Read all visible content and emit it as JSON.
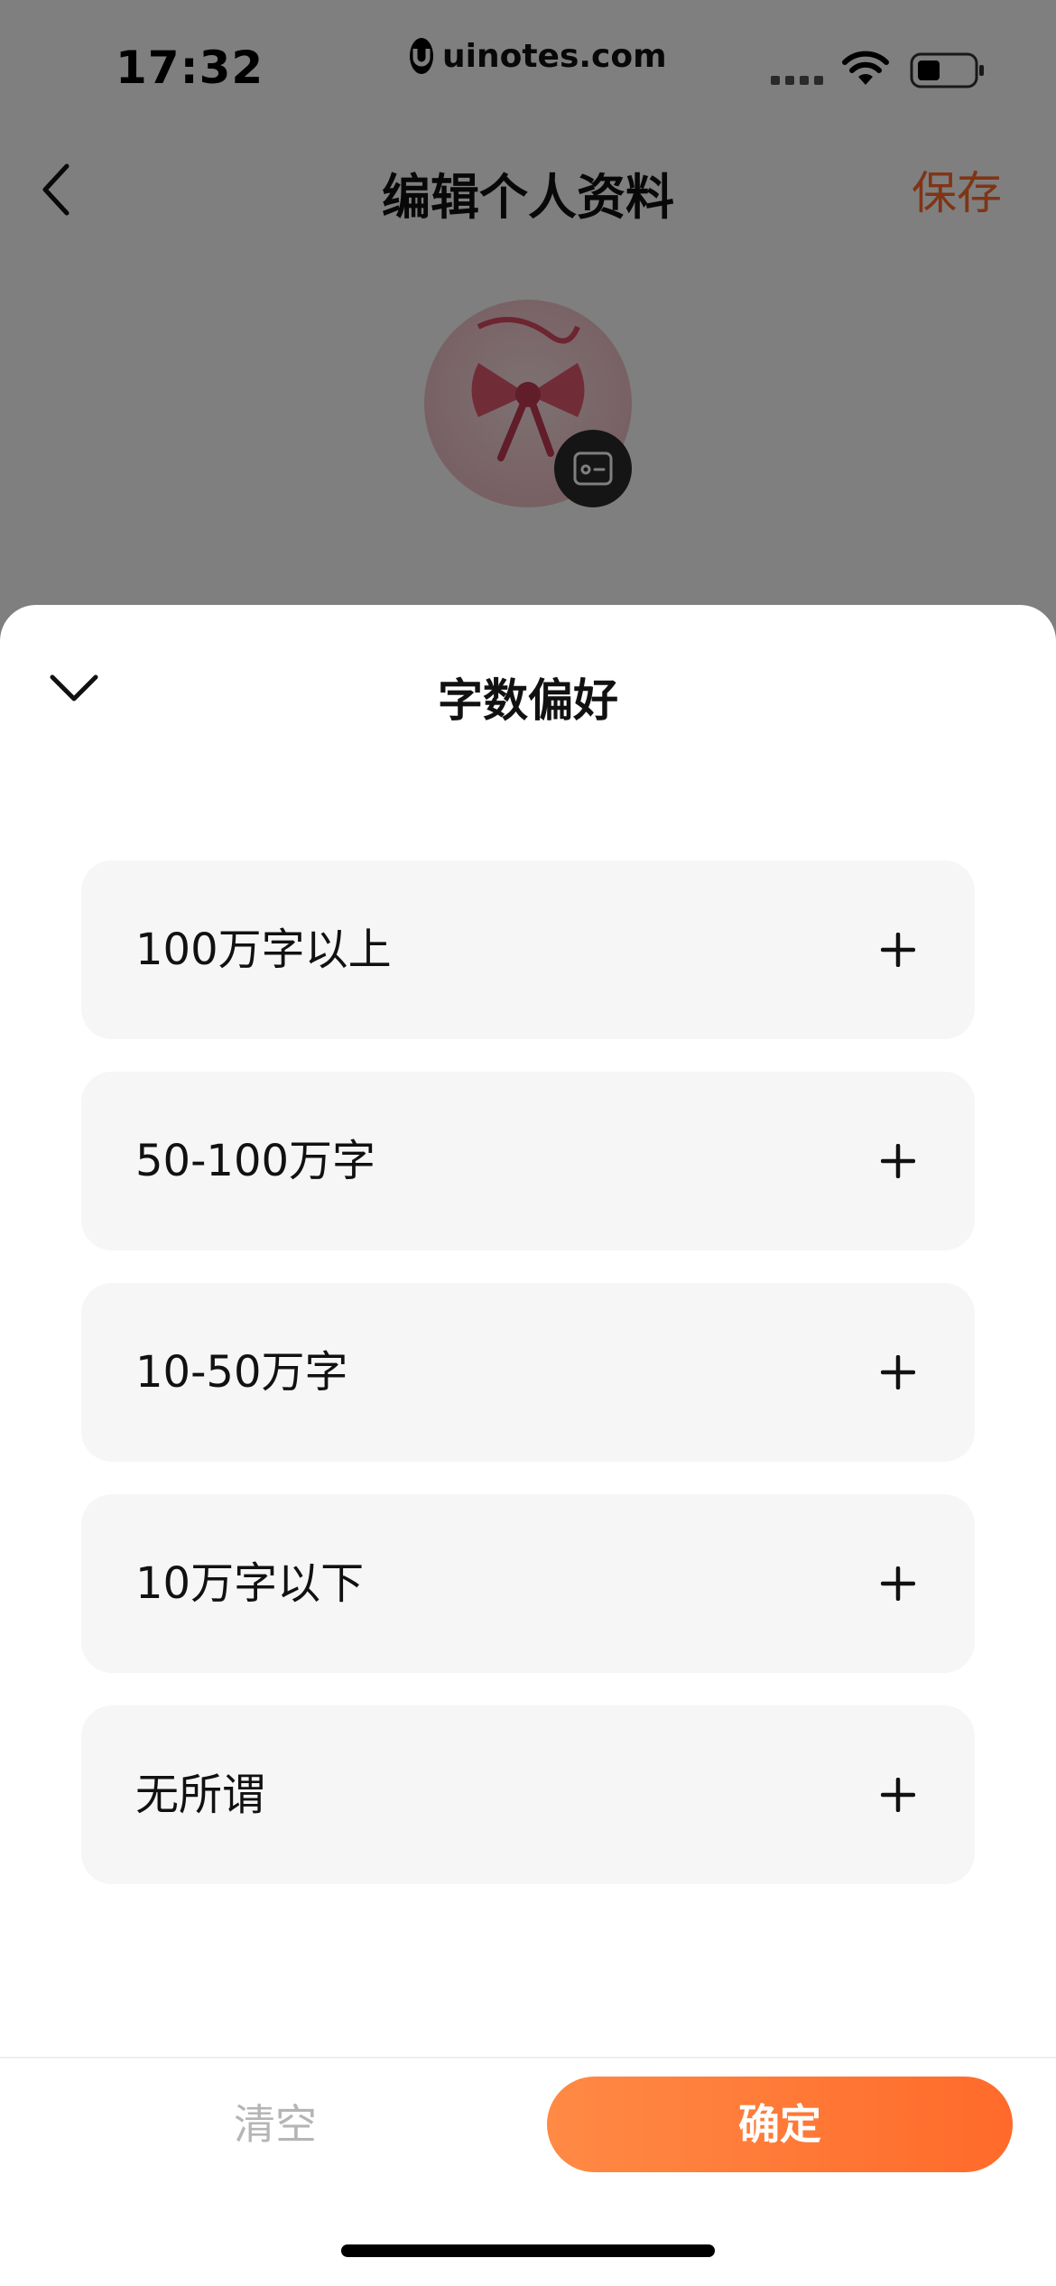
{
  "status_bar": {
    "time": "17:32",
    "url": "uinotes.com"
  },
  "nav": {
    "title": "编辑个人资料",
    "save_label": "保存"
  },
  "sheet": {
    "title": "字数偏好",
    "options": [
      {
        "label": "100万字以上"
      },
      {
        "label": "50-100万字"
      },
      {
        "label": "10-50万字"
      },
      {
        "label": "10万字以下"
      },
      {
        "label": "无所谓"
      }
    ],
    "clear_label": "清空",
    "confirm_label": "确定"
  },
  "colors": {
    "accent": "#ff6a2a",
    "option_bg": "#f6f6f6",
    "overlay": "rgba(0,0,0,0.5)"
  },
  "icons": {
    "back": "chevron-left-icon",
    "camera": "camera-icon",
    "collapse": "chevron-down-icon",
    "add": "plus-icon"
  }
}
